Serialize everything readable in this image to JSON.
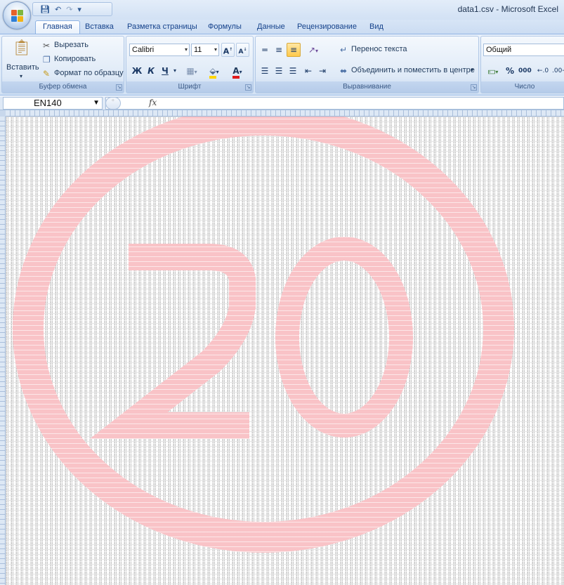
{
  "window": {
    "title": "data1.csv - Microsoft Excel"
  },
  "qat": {
    "icons": [
      "save-icon",
      "undo-icon",
      "redo-icon",
      "customize-icon"
    ]
  },
  "tabs": [
    "Главная",
    "Вставка",
    "Разметка страницы",
    "Формулы",
    "Данные",
    "Рецензирование",
    "Вид"
  ],
  "ribbon": {
    "clipboard": {
      "label": "Буфер обмена",
      "paste": "Вставить",
      "cut": "Вырезать",
      "copy": "Копировать",
      "format_painter": "Формат по образцу"
    },
    "font": {
      "label": "Шрифт",
      "font_name": "Calibri",
      "font_size": "11",
      "bold": "Ж",
      "italic": "К",
      "underline": "Ч"
    },
    "alignment": {
      "label": "Выравнивание",
      "wrap_text": "Перенос текста",
      "merge_center": "Объединить и поместить в центре"
    },
    "number": {
      "label": "Число",
      "format": "Общий",
      "percent": "%",
      "thousands": "000"
    }
  },
  "formula_bar": {
    "name_box": "EN140",
    "fx": "fx",
    "value": ""
  },
  "sheet": {
    "fill_color": "#f9c3c7",
    "grid_color": "#d9d9d9",
    "cell_text_color": "#bdbdbd"
  },
  "colors": {
    "ribbon_blue": "#d4e3f5",
    "tab_text": "#15428b",
    "title_text": "#1f3452"
  }
}
